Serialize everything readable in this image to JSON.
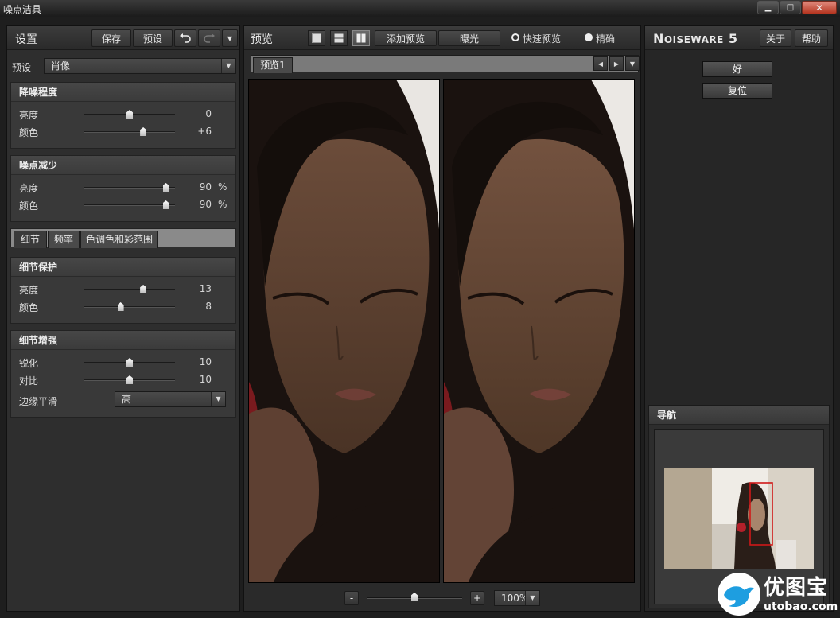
{
  "window": {
    "title": "噪点洁具",
    "minimize": "▁",
    "maximize": "□",
    "close": "✕"
  },
  "left": {
    "title": "设置",
    "save": "保存",
    "preset": "预设",
    "preset_label": "预设",
    "preset_value": "肖像",
    "noise_level": {
      "title": "降噪程度",
      "rows": [
        {
          "label": "亮度",
          "value": "0",
          "unit": "",
          "pos": 0.5
        },
        {
          "label": "颜色",
          "value": "+6",
          "unit": "",
          "pos": 0.65
        }
      ]
    },
    "noise_reduction": {
      "title": "噪点减少",
      "rows": [
        {
          "label": "亮度",
          "value": "90",
          "unit": "%",
          "pos": 0.9
        },
        {
          "label": "颜色",
          "value": "90",
          "unit": "%",
          "pos": 0.9
        }
      ]
    },
    "tabs": [
      "细节",
      "频率",
      "色调色和彩范围"
    ],
    "detail_protect": {
      "title": "细节保护",
      "rows": [
        {
          "label": "亮度",
          "value": "13",
          "unit": "",
          "pos": 0.65
        },
        {
          "label": "颜色",
          "value": "8",
          "unit": "",
          "pos": 0.4
        }
      ]
    },
    "detail_enhance": {
      "title": "细节增强",
      "rows": [
        {
          "label": "锐化",
          "value": "10",
          "unit": "",
          "pos": 0.5
        },
        {
          "label": "对比",
          "value": "10",
          "unit": "",
          "pos": 0.5
        }
      ],
      "edge_label": "边缘平滑",
      "edge_value": "高"
    }
  },
  "center": {
    "title": "预览",
    "add_preview": "添加预览",
    "exposure": "曝光",
    "fast_preview": "快速预览",
    "precise": "精确",
    "tab": "预览1",
    "zoom_minus": "-",
    "zoom_plus": "+",
    "zoom_value": "100%",
    "zoom_pos": 0.5
  },
  "right": {
    "logo_a": "N",
    "logo_b": "OISEWARE",
    "logo_c": " 5",
    "about": "关于",
    "help": "帮助",
    "ok": "好",
    "reset": "复位",
    "navigator": "导航"
  },
  "watermark": {
    "cn": "优图宝",
    "url": "utobao.com"
  },
  "colors": {
    "accent_red": "#d01818",
    "bird_blue": "#1e9ee0"
  }
}
